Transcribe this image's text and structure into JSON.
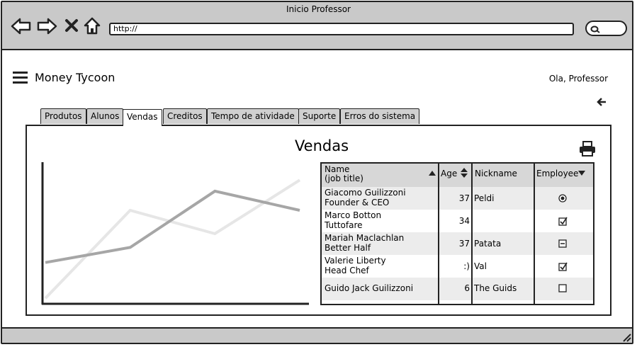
{
  "window": {
    "title": "Inicio Professor",
    "url_value": "http://"
  },
  "app": {
    "title": "Money Tycoon",
    "greeting": "Ola, Professor"
  },
  "tabs": [
    {
      "label": "Produtos",
      "active": false
    },
    {
      "label": "Alunos",
      "active": false
    },
    {
      "label": "Vendas",
      "active": true
    },
    {
      "label": "Creditos",
      "active": false
    },
    {
      "label": "Tempo de atividade",
      "active": false
    },
    {
      "label": "Suporte",
      "active": false
    },
    {
      "label": "Erros do sistema",
      "active": false
    }
  ],
  "panel": {
    "title": "Vendas"
  },
  "chart_data": {
    "type": "line",
    "title": "",
    "xlabel": "",
    "ylabel": "",
    "grid": false,
    "x": [
      0,
      1,
      2,
      3
    ],
    "ylim": [
      0,
      100
    ],
    "series": [
      {
        "color": "#a6a6a6",
        "values": [
          29,
          40,
          81,
          67
        ]
      },
      {
        "color": "#e6e6e6",
        "values": [
          3,
          67,
          50,
          89
        ]
      }
    ]
  },
  "table": {
    "columns": [
      {
        "label_line1": "Name",
        "label_line2": "(job title)",
        "sort_icon": "sort-ascending-icon"
      },
      {
        "label": "Age",
        "sort_icon": "sort-both-icon"
      },
      {
        "label": "Nickname"
      },
      {
        "label": "Employee",
        "sort_icon": "sort-descending-icon"
      }
    ],
    "rows": [
      {
        "name": "Giacomo Guilizzoni",
        "job": "Founder & CEO",
        "age": "37",
        "nickname": "Peldi",
        "employee": "radio-selected"
      },
      {
        "name": "Marco Botton",
        "job": "Tuttofare",
        "age": "34",
        "nickname": "",
        "employee": "checkbox-checked"
      },
      {
        "name": "Mariah Maclachlan",
        "job": "Better Half",
        "age": "37",
        "nickname": "Patata",
        "employee": "checkbox-indeterminate"
      },
      {
        "name": "Valerie Liberty",
        "job": "Head Chef",
        "age": ":)",
        "nickname": "Val",
        "employee": "checkbox-checked"
      },
      {
        "name": "Guido Jack Guilizzoni",
        "job": "",
        "age": "6",
        "nickname": "The Guids",
        "employee": "checkbox-unchecked"
      }
    ]
  }
}
